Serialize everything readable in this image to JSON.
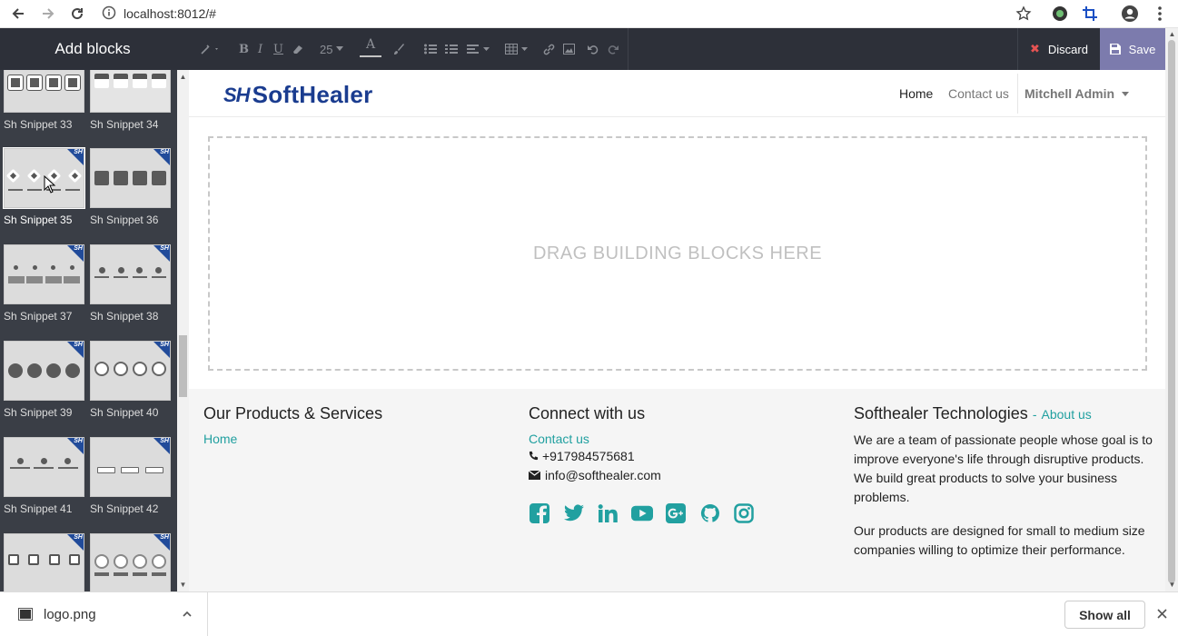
{
  "browser": {
    "url": "localhost:8012/#",
    "icons": [
      "back-arrow-icon",
      "forward-arrow-icon",
      "reload-icon",
      "info-icon",
      "star-icon",
      "extension-icon",
      "crop-icon",
      "account-icon",
      "menu-icon"
    ]
  },
  "panel": {
    "title": "Add blocks",
    "snippets": [
      {
        "label": "Sh Snippet 33"
      },
      {
        "label": "Sh Snippet 34"
      },
      {
        "label": "Sh Snippet 35"
      },
      {
        "label": "Sh Snippet 36"
      },
      {
        "label": "Sh Snippet 37"
      },
      {
        "label": "Sh Snippet 38"
      },
      {
        "label": "Sh Snippet 39"
      },
      {
        "label": "Sh Snippet 40"
      },
      {
        "label": "Sh Snippet 41"
      },
      {
        "label": "Sh Snippet 42"
      }
    ],
    "badge": "SH"
  },
  "toolbar": {
    "font_size": "25",
    "discard_label": "Discard",
    "save_label": "Save"
  },
  "site": {
    "logo_mark": "SH",
    "logo_text": "SoftHealer",
    "nav": {
      "home": "Home",
      "contact": "Contact us",
      "user": "Mitchell Admin"
    },
    "dropzone_text": "DRAG BUILDING BLOCKS HERE",
    "footer": {
      "products_title": "Our Products & Services",
      "products_link": "Home",
      "connect_title": "Connect with us",
      "connect_link": "Contact us",
      "phone": "+917984575681",
      "email": "info@softhealer.com",
      "about_title": "Softhealer Technologies",
      "about_sep": "-",
      "about_link": "About us",
      "about_text_1": "We are a team of passionate people whose goal is to improve everyone's life through disruptive products. We build great products to solve your business problems.",
      "about_text_2": "Our products are designed for small to medium size companies willing to optimize their performance."
    }
  },
  "download_bar": {
    "file_name": "logo.png",
    "show_all": "Show all"
  },
  "colors": {
    "link": "#21a0a0",
    "save_bg": "#7c7bad",
    "toolbar_bg": "#2d3039",
    "panel_bg": "#3a3e46"
  }
}
